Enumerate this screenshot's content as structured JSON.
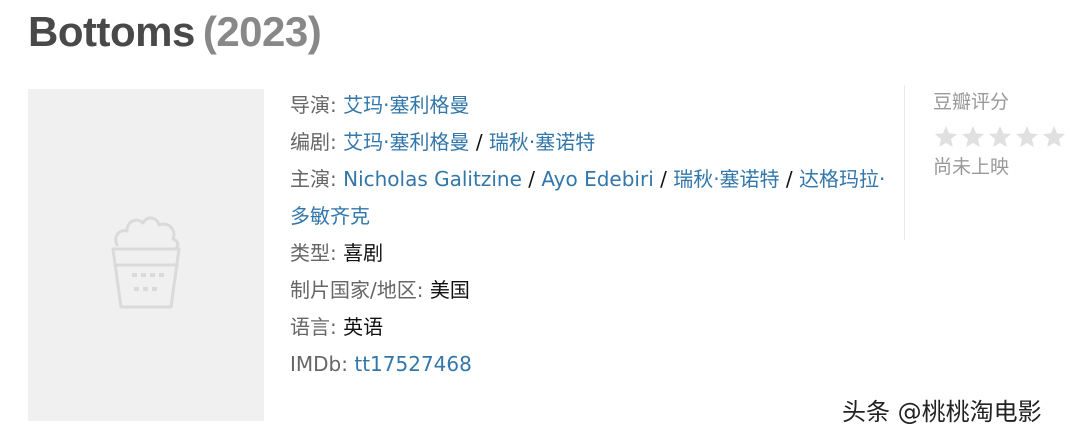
{
  "header": {
    "title": "Bottoms",
    "year": "(2023)"
  },
  "poster": {
    "icon": "popcorn-icon"
  },
  "info": {
    "director_label": "导演",
    "director": "艾玛·塞利格曼",
    "writer_label": "编剧",
    "writers": [
      "艾玛·塞利格曼",
      "瑞秋·塞诺特"
    ],
    "cast_label": "主演",
    "cast": [
      "Nicholas Galitzine",
      "Ayo Edebiri",
      "瑞秋·塞诺特",
      "达格玛拉·多敏齐克"
    ],
    "genre_label": "类型",
    "genre": "喜剧",
    "country_label": "制片国家/地区",
    "country": "美国",
    "language_label": "语言",
    "language": "英语",
    "imdb_label": "IMDb",
    "imdb": "tt17527468",
    "colon": ": ",
    "separator": " / "
  },
  "rating": {
    "label": "豆瓣评分",
    "stars_filled": 0,
    "stars_total": 5,
    "status": "尚未上映"
  },
  "watermark": {
    "text": "头条 @桃桃淘电影"
  },
  "colors": {
    "link": "#3377aa",
    "title": "#494949",
    "year": "#888888",
    "muted": "#999999",
    "poster_bg": "#f0f0f0",
    "star_empty": "#e0e0e0"
  }
}
